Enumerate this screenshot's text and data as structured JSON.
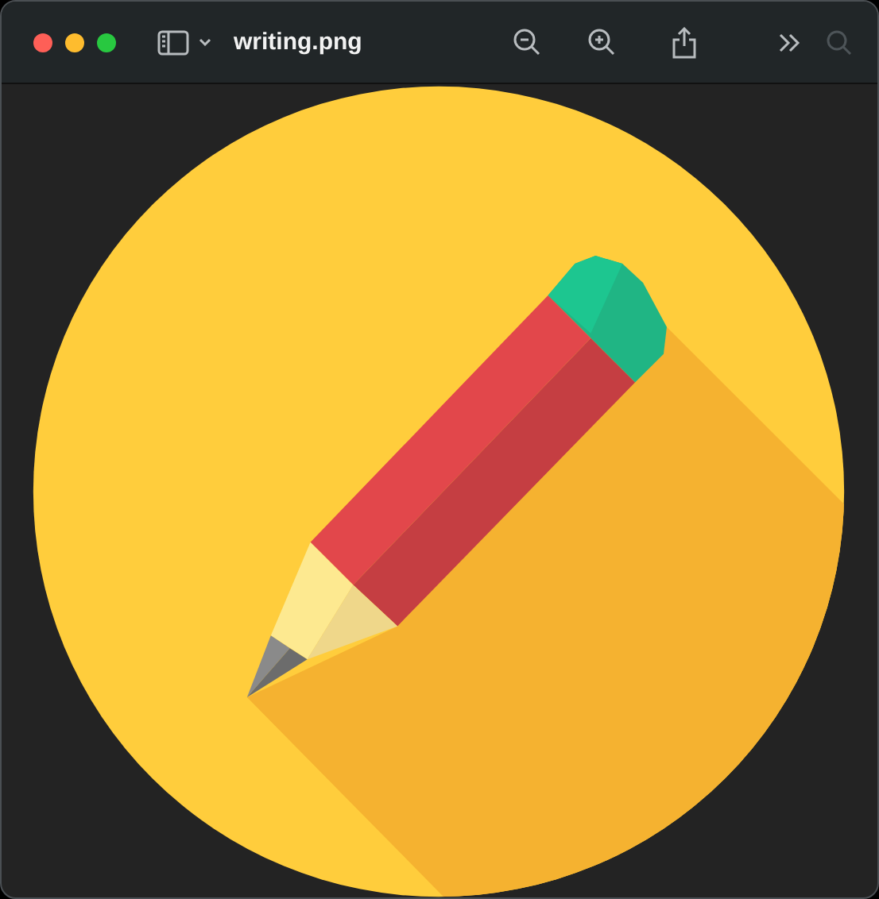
{
  "window": {
    "title": "writing.png"
  }
}
